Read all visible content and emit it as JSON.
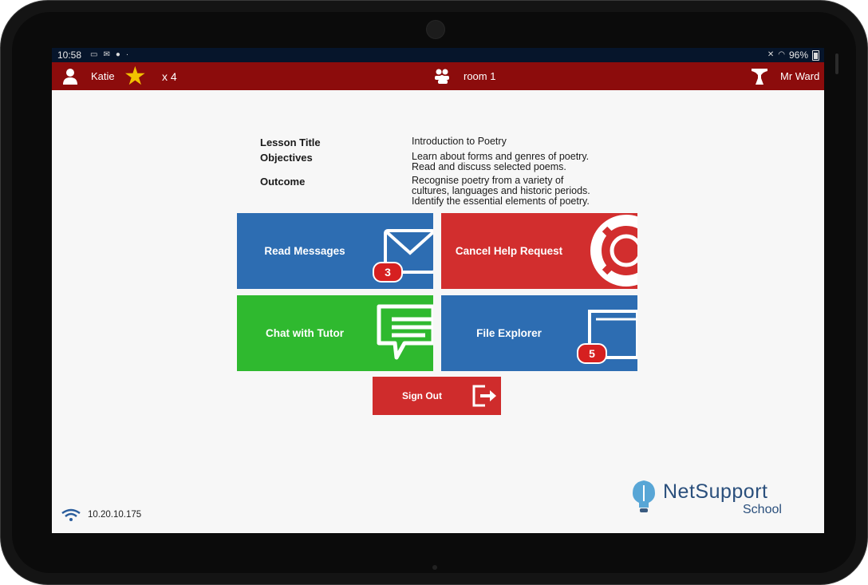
{
  "statusbar": {
    "time": "10:58",
    "battery": "96%"
  },
  "topbar": {
    "student": "Katie",
    "stars": "x 4",
    "room": "room 1",
    "tutor": "Mr Ward"
  },
  "lesson": {
    "title_label": "Lesson Title",
    "title_value": "Introduction to Poetry",
    "objectives_label": "Objectives",
    "objectives_lines": [
      "Learn about forms and genres of poetry.",
      "Read and discuss selected poems."
    ],
    "outcome_label": "Outcome",
    "outcome_lines": [
      "Recognise poetry from a variety of",
      "cultures, languages and historic periods.",
      "Identify the essential elements of poetry."
    ]
  },
  "tiles": {
    "read_messages": {
      "label": "Read Messages",
      "badge": "3",
      "color": "#2d6db2"
    },
    "cancel_help": {
      "label": "Cancel Help Request",
      "color": "#d22e2e"
    },
    "chat_tutor": {
      "label": "Chat with Tutor",
      "color": "#2fb92f"
    },
    "file_explorer": {
      "label": "File Explorer",
      "badge": "5",
      "color": "#2d6db2"
    },
    "sign_out": {
      "label": "Sign Out",
      "color": "#cf2c2c"
    }
  },
  "footer": {
    "ip": "10.20.10.175",
    "logo_text": "NetSupport",
    "logo_sub": "School"
  },
  "icons": [
    "user-icon",
    "star-icon",
    "group-icon",
    "tutor-icon",
    "envelope-icon",
    "lifebuoy-icon",
    "chat-bubble-icon",
    "folder-icon",
    "exit-icon",
    "wifi-icon"
  ]
}
